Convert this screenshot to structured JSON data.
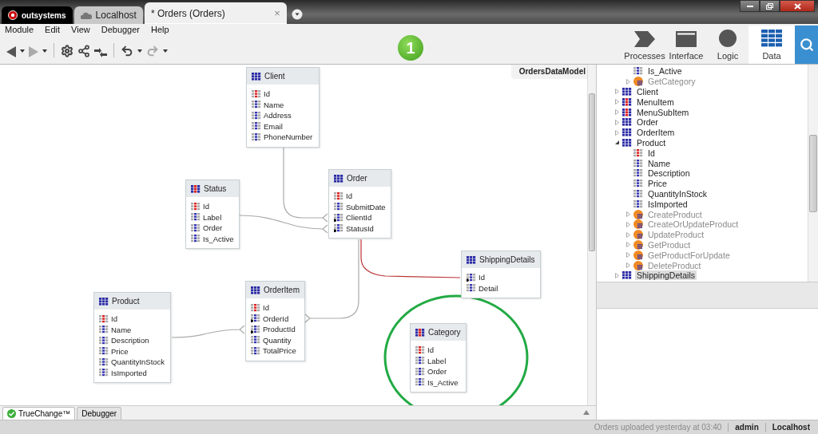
{
  "window_tabs": [
    {
      "kind": "logo",
      "label": "outsystems",
      "selected": false
    },
    {
      "kind": "server",
      "label": "Localhost",
      "selected": false
    },
    {
      "kind": "document",
      "label": "* Orders (Orders)",
      "selected": true,
      "close": "×"
    }
  ],
  "menu": [
    "Module",
    "Edit",
    "View",
    "Debugger",
    "Help"
  ],
  "publish_badge": "1",
  "nav": [
    {
      "kind": "processes",
      "label": "Processes",
      "selected": false
    },
    {
      "kind": "interface",
      "label": "Interface",
      "selected": false
    },
    {
      "kind": "logic",
      "label": "Logic",
      "selected": false
    },
    {
      "kind": "data",
      "label": "Data",
      "selected": true
    }
  ],
  "diagram": {
    "title": "OrdersDataModel",
    "entities": [
      {
        "name": "Client",
        "static": false,
        "fields": [
          {
            "name": "Id",
            "kind": "key"
          },
          {
            "name": "Name",
            "kind": "attr"
          },
          {
            "name": "Address",
            "kind": "attr"
          },
          {
            "name": "Email",
            "kind": "attr"
          },
          {
            "name": "PhoneNumber",
            "kind": "attr"
          }
        ]
      },
      {
        "name": "Status",
        "static": true,
        "fields": [
          {
            "name": "Id",
            "kind": "key"
          },
          {
            "name": "Label",
            "kind": "attr"
          },
          {
            "name": "Order",
            "kind": "attr"
          },
          {
            "name": "Is_Active",
            "kind": "attr"
          }
        ]
      },
      {
        "name": "Order",
        "static": false,
        "fields": [
          {
            "name": "Id",
            "kind": "key"
          },
          {
            "name": "SubmitDate",
            "kind": "attr"
          },
          {
            "name": "ClientId",
            "kind": "fk"
          },
          {
            "name": "StatusId",
            "kind": "fk"
          }
        ]
      },
      {
        "name": "ShippingDetails",
        "static": false,
        "fields": [
          {
            "name": "Id",
            "kind": "fk"
          },
          {
            "name": "Detail",
            "kind": "attr"
          }
        ]
      },
      {
        "name": "Product",
        "static": false,
        "fields": [
          {
            "name": "Id",
            "kind": "key"
          },
          {
            "name": "Name",
            "kind": "attr"
          },
          {
            "name": "Description",
            "kind": "attr"
          },
          {
            "name": "Price",
            "kind": "attr"
          },
          {
            "name": "QuantityInStock",
            "kind": "attr"
          },
          {
            "name": "IsImported",
            "kind": "attr"
          }
        ]
      },
      {
        "name": "OrderItem",
        "static": false,
        "fields": [
          {
            "name": "Id",
            "kind": "key"
          },
          {
            "name": "OrderId",
            "kind": "fk"
          },
          {
            "name": "ProductId",
            "kind": "fk"
          },
          {
            "name": "Quantity",
            "kind": "attr"
          },
          {
            "name": "TotalPrice",
            "kind": "attr"
          }
        ]
      },
      {
        "name": "Category",
        "static": true,
        "fields": [
          {
            "name": "Id",
            "kind": "key"
          },
          {
            "name": "Label",
            "kind": "attr"
          },
          {
            "name": "Order",
            "kind": "attr"
          },
          {
            "name": "Is_Active",
            "kind": "attr"
          }
        ]
      }
    ]
  },
  "tree": {
    "continued": [
      {
        "name": "Is_Active",
        "kind": "attr"
      },
      {
        "name": "GetCategory",
        "kind": "action",
        "expanded": false
      }
    ],
    "items": [
      {
        "name": "Client",
        "kind": "entity",
        "expanded": false,
        "selected": false
      },
      {
        "name": "MenuItem",
        "kind": "static",
        "expanded": false,
        "selected": false
      },
      {
        "name": "MenuSubItem",
        "kind": "static",
        "expanded": false,
        "selected": false
      },
      {
        "name": "Order",
        "kind": "entity",
        "expanded": false,
        "selected": false
      },
      {
        "name": "OrderItem",
        "kind": "entity",
        "expanded": false,
        "selected": false
      },
      {
        "name": "Product",
        "kind": "entity",
        "expanded": true,
        "selected": false,
        "children": [
          {
            "name": "Id",
            "kind": "key"
          },
          {
            "name": "Name",
            "kind": "attr"
          },
          {
            "name": "Description",
            "kind": "attr"
          },
          {
            "name": "Price",
            "kind": "attr"
          },
          {
            "name": "QuantityInStock",
            "kind": "attr"
          },
          {
            "name": "IsImported",
            "kind": "attr"
          },
          {
            "name": "CreateProduct",
            "kind": "action",
            "expanded": false
          },
          {
            "name": "CreateOrUpdateProduct",
            "kind": "action",
            "expanded": false
          },
          {
            "name": "UpdateProduct",
            "kind": "action",
            "expanded": false
          },
          {
            "name": "GetProduct",
            "kind": "action",
            "expanded": false
          },
          {
            "name": "GetProductForUpdate",
            "kind": "action",
            "expanded": false
          },
          {
            "name": "DeleteProduct",
            "kind": "action",
            "expanded": false
          }
        ]
      },
      {
        "name": "ShippingDetails",
        "kind": "entity",
        "expanded": false,
        "selected": true
      }
    ]
  },
  "bottom_tabs": [
    {
      "label": "TrueChange™",
      "kind": "truechange",
      "selected": true
    },
    {
      "label": "Debugger",
      "kind": "plain",
      "selected": false
    }
  ],
  "status_bar": {
    "message": "Orders uploaded yesterday at 03:40",
    "user": "admin",
    "server": "Localhost"
  }
}
